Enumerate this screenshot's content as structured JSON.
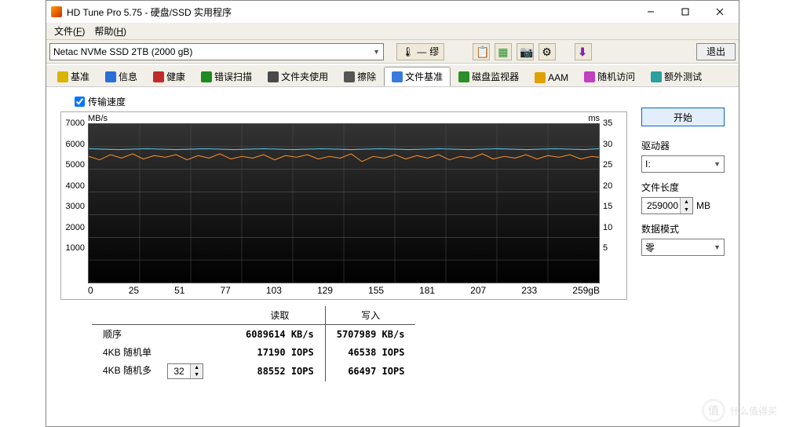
{
  "window": {
    "title": "HD Tune Pro 5.75 - 硬盘/SSD 实用程序"
  },
  "menubar": {
    "file": "文件",
    "file_key": "F",
    "help": "帮助",
    "help_key": "H"
  },
  "toolbar": {
    "drive": "Netac NVMe SSD 2TB (2000 gB)",
    "temp_marker": "—",
    "temp_text": "缪",
    "exit": "退出"
  },
  "tabs": [
    {
      "label": "基准",
      "icon_color": "#d9b400"
    },
    {
      "label": "信息",
      "icon_color": "#2a6fd6"
    },
    {
      "label": "健康",
      "icon_color": "#c12a2a"
    },
    {
      "label": "错误扫描",
      "icon_color": "#1f8a1f"
    },
    {
      "label": "文件夹使用",
      "icon_color": "#4a4a4a"
    },
    {
      "label": "擦除",
      "icon_color": "#555"
    },
    {
      "label": "文件基准",
      "icon_color": "#3a7adf"
    },
    {
      "label": "磁盘监视器",
      "icon_color": "#2a8f2a"
    },
    {
      "label": "AAM",
      "icon_color": "#e0a000"
    },
    {
      "label": "随机访问",
      "icon_color": "#c040c0"
    },
    {
      "label": "额外测试",
      "icon_color": "#2aa0a0"
    }
  ],
  "active_tab": 6,
  "checkbox": {
    "label": "传输速度",
    "checked": true
  },
  "chart_data": {
    "type": "line",
    "title": "",
    "x_range": [
      0,
      259
    ],
    "x_unit": "gB",
    "x_ticks": [
      0,
      25,
      51,
      77,
      103,
      129,
      155,
      181,
      207,
      233,
      "259gB"
    ],
    "y_left": {
      "label": "MB/s",
      "min": 0,
      "max": 7000,
      "ticks": [
        7000,
        6000,
        5000,
        4000,
        3000,
        2000,
        1000
      ]
    },
    "y_right": {
      "label": "ms",
      "min": 0,
      "max": 35,
      "ticks": [
        35,
        30,
        25,
        20,
        15,
        10,
        5
      ]
    },
    "series": [
      {
        "name": "read_speed",
        "axis": "left",
        "color": "#5cc6e8",
        "approx_value": 5900,
        "note": "nearly constant ~5900 MB/s across full range"
      },
      {
        "name": "write_speed",
        "axis": "left",
        "color": "#f08a2a",
        "approx_value": 5600,
        "note": "fluctuating ~5400-5700 MB/s across full range"
      }
    ]
  },
  "results": {
    "headers": [
      "",
      "读取",
      "写入"
    ],
    "rows": [
      {
        "label": "顺序",
        "read": "6089614",
        "read_unit": "KB/s",
        "write": "5707989",
        "write_unit": "KB/s"
      },
      {
        "label": "4KB 随机单",
        "read": "17190",
        "read_unit": "IOPS",
        "write": "46538",
        "write_unit": "IOPS"
      },
      {
        "label": "4KB 随机多",
        "read": "88552",
        "read_unit": "IOPS",
        "write": "66497",
        "write_unit": "IOPS"
      }
    ],
    "queue_depth": "32"
  },
  "side": {
    "start": "开始",
    "drive_label": "驱动器",
    "drive_value": "I:",
    "file_len_label": "文件长度",
    "file_len_value": "259000",
    "file_len_unit": "MB",
    "data_mode_label": "数据模式",
    "data_mode_value": "零"
  },
  "watermark": "什么值得买"
}
